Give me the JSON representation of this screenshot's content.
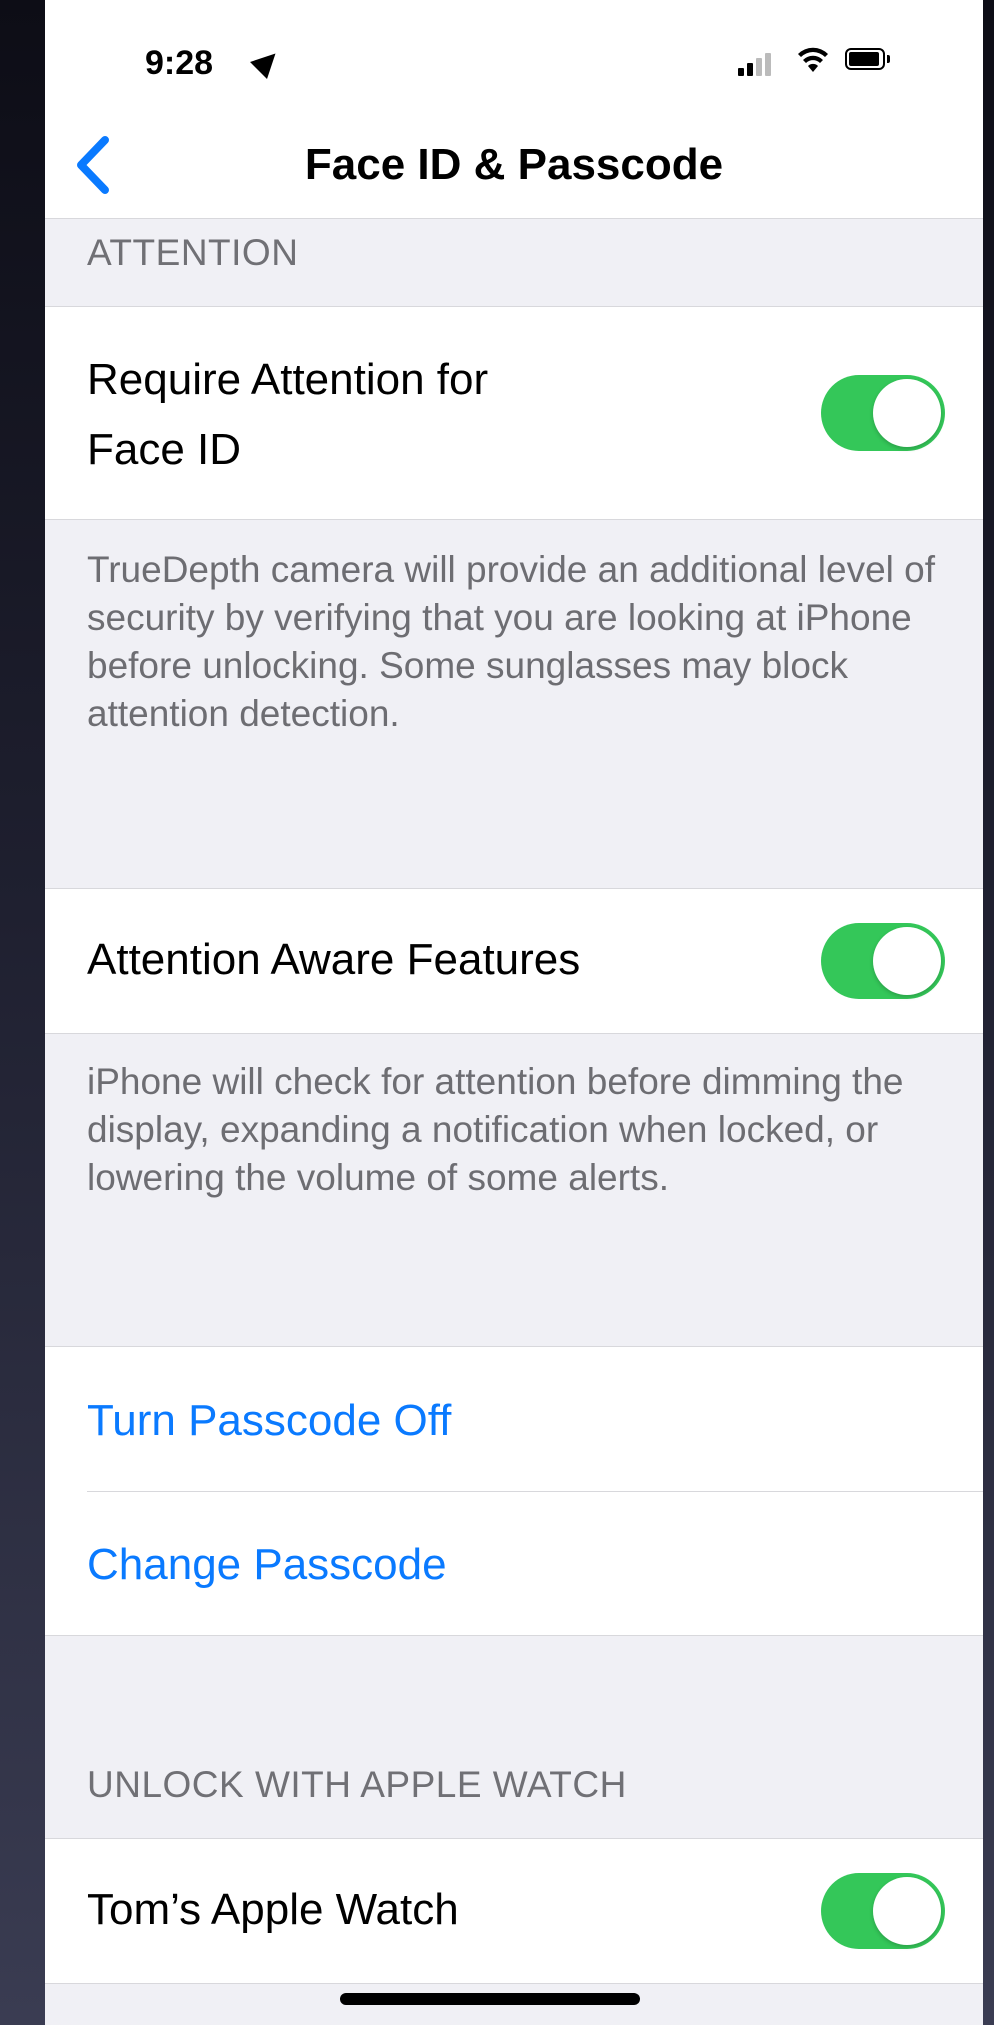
{
  "status_bar": {
    "time": "9:28"
  },
  "nav": {
    "title": "Face ID & Passcode"
  },
  "sections": {
    "attention_header": "ATTENTION",
    "require_attention": {
      "label_line1": "Require Attention for",
      "label_line2": "Face ID",
      "enabled": true
    },
    "require_attention_footer": "TrueDepth camera will provide an additional level of security by verifying that you are looking at iPhone before unlocking. Some sunglasses may block attention detection.",
    "attention_aware": {
      "label": "Attention Aware Features",
      "enabled": true
    },
    "attention_aware_footer": "iPhone will check for attention before dimming the display, expanding a notification when locked, or lowering the volume of some alerts.",
    "turn_passcode_off": "Turn Passcode Off",
    "change_passcode": "Change Passcode",
    "apple_watch_header": "UNLOCK WITH APPLE WATCH",
    "apple_watch": {
      "label": "Tom’s Apple Watch",
      "enabled": true
    }
  },
  "colors": {
    "accent": "#0a7aff",
    "toggle_on": "#34c759"
  }
}
